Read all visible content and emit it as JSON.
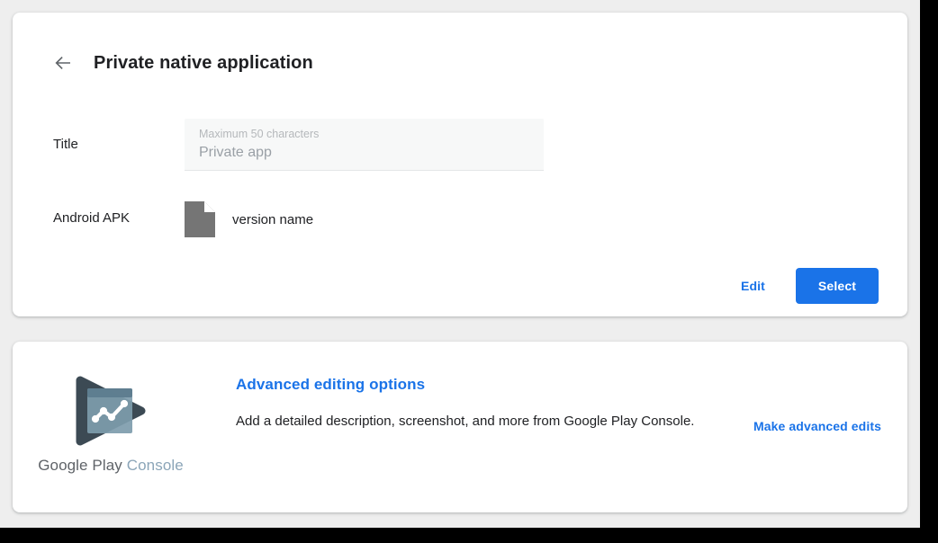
{
  "header": {
    "back_icon": "arrow-left-icon",
    "title": "Private native application"
  },
  "form": {
    "title_label": "Title",
    "title_hint": "Maximum 50 characters",
    "title_value": "Private app",
    "apk_label": "Android APK",
    "apk_icon": "file-document-icon",
    "apk_version": "version name"
  },
  "actions": {
    "edit_label": "Edit",
    "select_label": "Select"
  },
  "advanced": {
    "logo_icon": "google-play-console-logo",
    "wordmark_primary": "Google Play",
    "wordmark_secondary": "Console",
    "title": "Advanced editing options",
    "description": "Add a detailed description, screenshot, and more from Google Play Console.",
    "link_label": "Make advanced edits"
  },
  "colors": {
    "accent_blue": "#1a73e8",
    "page_background": "#eeeeee",
    "card_background": "#ffffff",
    "text_primary": "#202124",
    "text_muted": "#9aa0a6",
    "field_background": "#f7f8f8",
    "logo_dark": "#3c4a54",
    "logo_light": "#7e9cad",
    "wordmark_secondary_color": "#8ba5b8"
  }
}
